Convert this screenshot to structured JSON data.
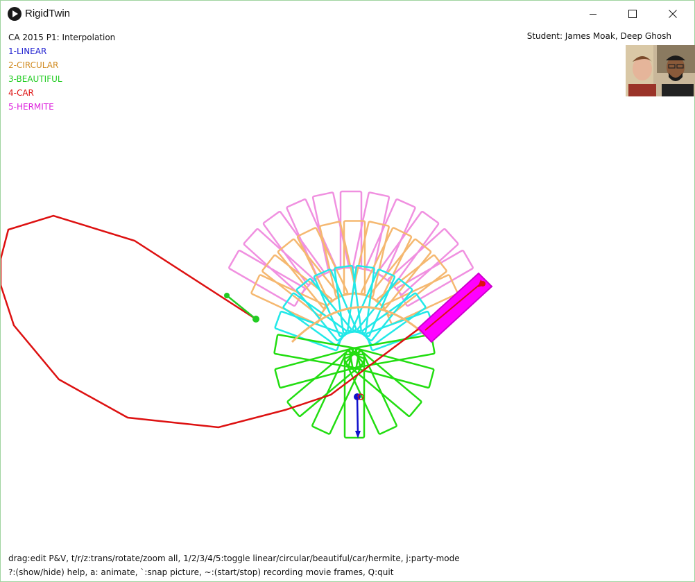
{
  "window": {
    "title": "RigidTwin",
    "icon": "processing-play-icon",
    "controls": {
      "minimize": "minimize-icon",
      "maximize": "maximize-icon",
      "close": "close-icon"
    }
  },
  "header": {
    "project_title": "CA 2015 P1: Interpolation",
    "student": "Student: James Moak, Deep Ghosh"
  },
  "menu": [
    {
      "label": "1-LINEAR",
      "color": "#2020d0"
    },
    {
      "label": "2-CIRCULAR",
      "color": "#d08a20"
    },
    {
      "label": "3-BEAUTIFUL",
      "color": "#22cc22"
    },
    {
      "label": "4-CAR",
      "color": "#dd1111"
    },
    {
      "label": "5-HERMITE",
      "color": "#dd22dd"
    }
  ],
  "help": {
    "line1": "drag:edit P&V, t/r/z:trans/rotate/zoom all, 1/2/3/4/5:toggle linear/circular/beautiful/car/hermite, j:party-mode",
    "line2": "?:(show/hide) help, a: animate, `:snap picture, ~:(start/stop) recording movie frames, Q:quit"
  },
  "colors": {
    "linear": "#1010cc",
    "circular": "#f5b870",
    "beautiful": "#22dd11",
    "car": "#dd1111",
    "hermite": "#f090e0",
    "cyan": "#22e8e8",
    "magenta": "#ff00ff"
  }
}
